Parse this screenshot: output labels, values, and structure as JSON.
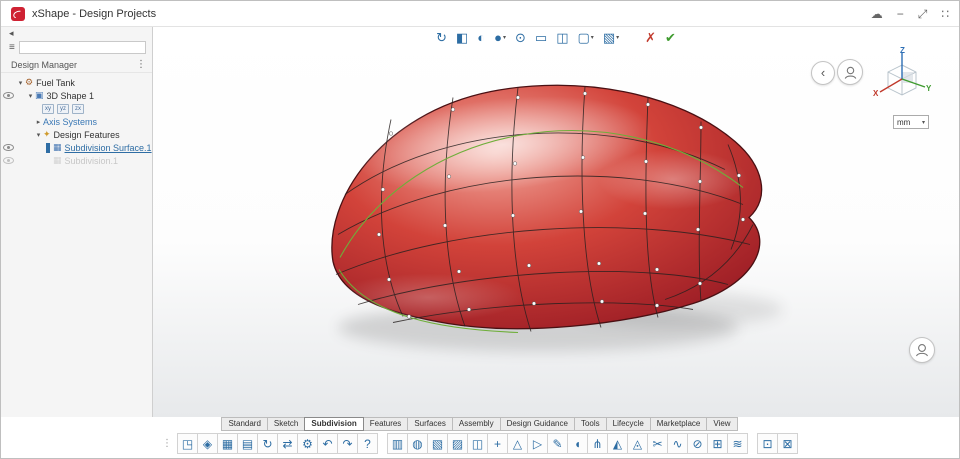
{
  "titlebar": {
    "title": "xShape - Design Projects",
    "icons": {
      "cloud": "☁",
      "minimize": "−",
      "fullscreen": "⤢",
      "apps": "∷"
    }
  },
  "panel": {
    "collapse_glyph": "◂",
    "tree_toggle_glyph": "≡",
    "search_value": "",
    "header": "Design Manager",
    "kebab_glyph": "⋮",
    "tree": {
      "root": {
        "caret": "▾",
        "icon": "⚙",
        "label": "Fuel Tank"
      },
      "shape": {
        "caret": "▾",
        "icon": "▣",
        "label": "3D Shape 1"
      },
      "planes": [
        {
          "label": "xy"
        },
        {
          "label": "yz"
        },
        {
          "label": "zx"
        }
      ],
      "axis": {
        "caret": "▸",
        "label": "Axis Systems"
      },
      "features": {
        "caret": "▾",
        "icon": "✦",
        "label": "Design Features"
      },
      "subdivision": {
        "icon": "▦",
        "label": "Subdivision Surface.1"
      },
      "inactive": {
        "icon": "▦",
        "label": "Subdivision.1"
      }
    }
  },
  "viewport": {
    "toolbar": [
      {
        "name": "update-icon",
        "glyph": "↻"
      },
      {
        "name": "material-view-icon",
        "glyph": "◧"
      },
      {
        "name": "ambience-icon",
        "glyph": "◐"
      },
      {
        "name": "render-style-icon",
        "glyph": "●",
        "caret": "▾"
      },
      {
        "name": "magnify-icon",
        "glyph": "⊙"
      },
      {
        "name": "capture-icon",
        "glyph": "▭"
      },
      {
        "name": "section-icon",
        "glyph": "◫"
      },
      {
        "name": "marquee-icon",
        "glyph": "▢",
        "caret": "▾"
      },
      {
        "name": "view-mode-icon",
        "glyph": "▧",
        "caret": "▾"
      },
      {
        "name": "cancel-icon",
        "glyph": "✗",
        "style": "color:#c23b2e;font-weight:bold"
      },
      {
        "name": "ok-icon",
        "glyph": "✔",
        "style": "color:#3f9b2f;font-weight:bold"
      }
    ],
    "nav": {
      "back_glyph": "‹"
    },
    "triad": {
      "x": "X",
      "y": "Y",
      "z": "Z",
      "x_color": "#c0392b",
      "y_color": "#3f9b2f",
      "z_color": "#2e6fb5"
    },
    "units": {
      "value": "mm",
      "caret": "▾"
    },
    "model": {
      "highlight_color": "#f2a99e",
      "mid_color": "#d2433a",
      "base_color": "#8f1420",
      "outline_color": "#4a1013",
      "cage_color": "#26201f",
      "edit_curve_color": "#6fae3a",
      "vertex_color": "#ffffff"
    }
  },
  "bottom": {
    "tabs": [
      "Standard",
      "Sketch",
      "Subdivision",
      "Features",
      "Surfaces",
      "Assembly",
      "Design Guidance",
      "Tools",
      "Lifecycle",
      "Marketplace",
      "View"
    ],
    "active_tab": "Subdivision",
    "group1": [
      {
        "name": "share-icon",
        "glyph": "◳"
      },
      {
        "name": "content-icon",
        "glyph": "◈"
      },
      {
        "name": "save-icon",
        "glyph": "▦"
      },
      {
        "name": "print-icon",
        "glyph": "▤"
      },
      {
        "name": "update-icon",
        "glyph": "↻"
      },
      {
        "name": "transfer-icon",
        "glyph": "⇄"
      },
      {
        "name": "settings-icon",
        "glyph": "⚙"
      },
      {
        "name": "undo-icon",
        "glyph": "↶"
      },
      {
        "name": "redo-icon",
        "glyph": "↷"
      },
      {
        "name": "help-icon",
        "glyph": "?"
      }
    ],
    "group2": [
      {
        "name": "catalog-icon",
        "glyph": "▥"
      },
      {
        "name": "primitive-sphere-icon",
        "glyph": "◍"
      },
      {
        "name": "primitive-box-icon",
        "glyph": "▧"
      },
      {
        "name": "image-support-icon",
        "glyph": "▨"
      },
      {
        "name": "frame-icon",
        "glyph": "◫"
      },
      {
        "name": "axis-system-icon",
        "glyph": "+"
      },
      {
        "name": "cone-icon",
        "glyph": "△"
      },
      {
        "name": "loft-icon",
        "glyph": "▷"
      },
      {
        "name": "sketch-icon",
        "glyph": "✎"
      },
      {
        "name": "annotation-icon",
        "glyph": "◖"
      },
      {
        "name": "split-icon",
        "glyph": "⋔"
      },
      {
        "name": "prism-icon",
        "glyph": "◭"
      },
      {
        "name": "rotate-body-icon",
        "glyph": "◬"
      },
      {
        "name": "scissors-icon",
        "glyph": "✂"
      },
      {
        "name": "spline-icon",
        "glyph": "∿"
      },
      {
        "name": "trim-icon",
        "glyph": "⊘"
      },
      {
        "name": "extrude-icon",
        "glyph": "⊞"
      },
      {
        "name": "sweep-icon",
        "glyph": "≋"
      }
    ],
    "group3": [
      {
        "name": "subdivision-cube-icon",
        "glyph": "⊡"
      },
      {
        "name": "mesh-cube-icon",
        "glyph": "⊠"
      }
    ]
  }
}
